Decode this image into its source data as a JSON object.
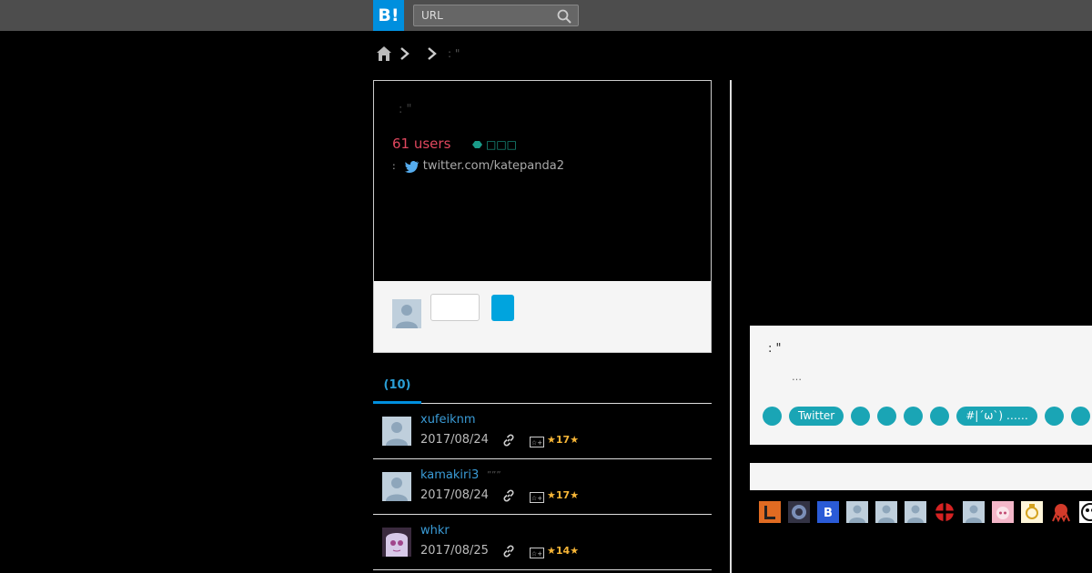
{
  "header": {
    "logo_text": "B!",
    "search_placeholder": "URL",
    "search_icon": "search-icon"
  },
  "breadcrumb": {
    "home_icon": "home-icon",
    "current": ": \""
  },
  "entry": {
    "title": ": \"",
    "users": "61 users",
    "category": "□□□",
    "source_sep": ":",
    "source_url": "twitter.com/katepanda2"
  },
  "tabs": [
    {
      "label": "(10)"
    }
  ],
  "bookmarks": [
    {
      "user": "xufeiknm",
      "comment": "",
      "date": "2017/08/24",
      "stars": "17"
    },
    {
      "user": "kamakiri3",
      "comment": "”””",
      "date": "2017/08/24",
      "stars": "17"
    },
    {
      "user": "whkr",
      "comment": "",
      "date": "2017/08/25",
      "stars": "14"
    }
  ],
  "related": {
    "title": ": \"",
    "desc": "…",
    "tags": [
      "",
      "Twitter",
      "",
      "",
      "",
      "",
      "#|´ω`) ……",
      "",
      ""
    ]
  },
  "colors": {
    "accent": "#008fde",
    "users": "#e0475e",
    "tag": "#1aa5b5",
    "star": "#f8b637"
  }
}
